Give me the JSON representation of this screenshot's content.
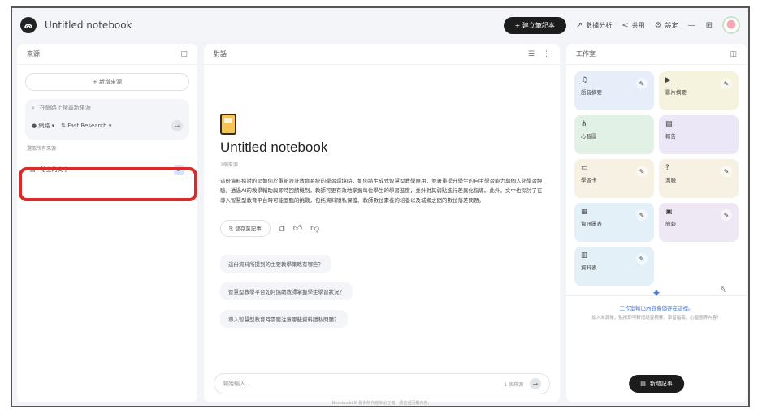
{
  "topbar": {
    "title": "Untitled notebook",
    "create_button": "+ 建立筆記本",
    "analytics": "數據分析",
    "share": "共用",
    "settings": "設定",
    "icons": [
      "minus-icon",
      "grid-icon",
      "avatar"
    ]
  },
  "left": {
    "title": "來源",
    "add_source": "+ 新增來源",
    "search_placeholder": "在網路上搜尋新來源",
    "mode": "網路",
    "research_option": "Fast Research",
    "select_all": "選取所有來源",
    "source_name": "貼上的文字"
  },
  "middle": {
    "title": "對話",
    "notebook_title": "Untitled notebook",
    "meta": "1個來源",
    "summary": "這份資料探討的是如何於重新設計教育系統的學習環境時，如何將生成式智慧型教學應用，並著重提升學生的自主學習能力與個人化學習經驗。透過AI的教學輔助與即時回饋機制，教師可更有效地掌握每位學生的學習進度，並針對其弱點進行差異化指導。此外，文中也探討了在導入智慧型教育平台時可能面臨的挑戰，包括資料隱私保護、教師數位素養的培養以及城鄉之間的數位落差問題。",
    "save_note": "儲存至記事",
    "suggestions": [
      "這份資料所提到的主要教學策略有哪些？",
      "智慧型教學平台如何協助教師掌握學生學習狀況？",
      "導入智慧型教育時需要注意哪些資料隱私問題？"
    ],
    "chat_placeholder": "開始輸入…",
    "source_count": "1 個來源"
  },
  "right": {
    "title": "工作室",
    "tiles": [
      {
        "label": "語音摘要",
        "icon": "audio-icon",
        "color": "#e7eefa",
        "editable": true
      },
      {
        "label": "影片摘要",
        "icon": "video-icon",
        "color": "#f5f3dd",
        "editable": true
      },
      {
        "label": "心智圖",
        "icon": "mindmap-icon",
        "color": "#e2f1e6",
        "editable": false
      },
      {
        "label": "報告",
        "icon": "report-icon",
        "color": "#ece7f6",
        "editable": false
      },
      {
        "label": "學習卡",
        "icon": "flashcard-icon",
        "color": "#f6f1e2",
        "editable": true
      },
      {
        "label": "測驗",
        "icon": "quiz-icon",
        "color": "#f6f1e2",
        "editable": true
      },
      {
        "label": "資訊圖表",
        "icon": "infographic-icon",
        "color": "#e4f0f8",
        "editable": true
      },
      {
        "label": "簡報",
        "icon": "slides-icon",
        "color": "#eee8f5",
        "editable": true
      },
      {
        "label": "資料表",
        "icon": "table-icon",
        "color": "#e4f0f8",
        "editable": true
      }
    ],
    "empty_title": "工作室輸出內容會儲存在這裡。",
    "empty_desc": "加入來源後，點按即可新增語音摘要、學習指南、心智圖等內容！",
    "add_note": "新增記事"
  },
  "footer": "NotebookLM 提供的內容未必正確，請查證回覆內容。"
}
